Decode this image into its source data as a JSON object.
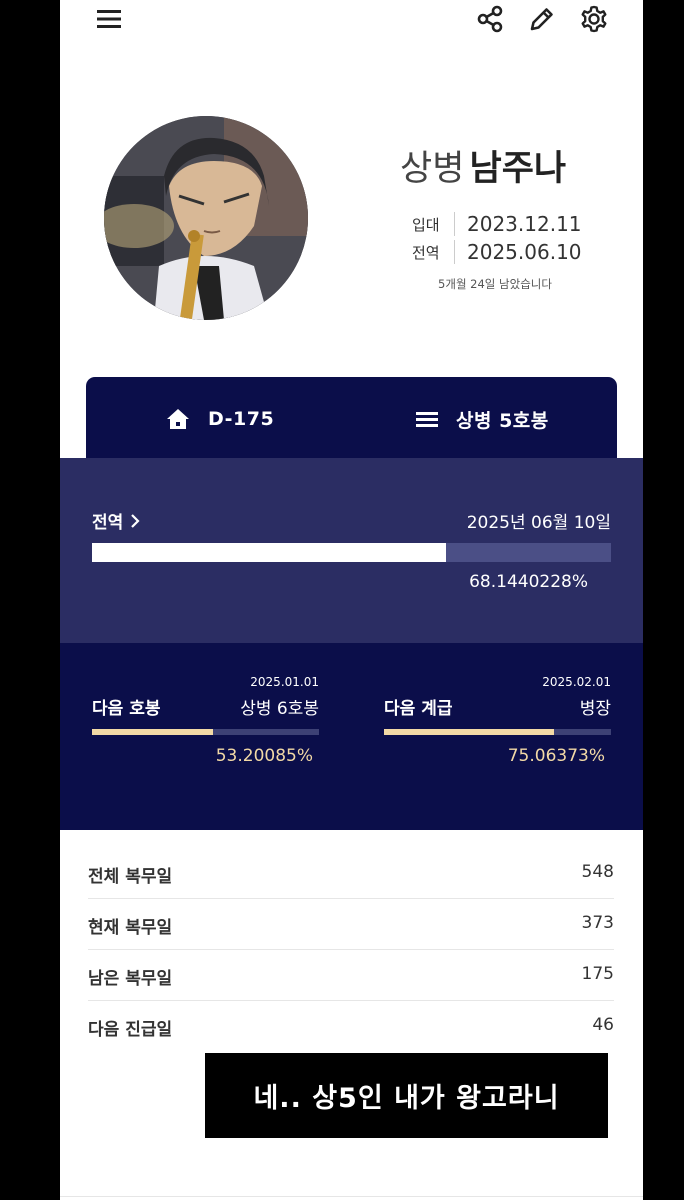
{
  "profile": {
    "rank": "상병",
    "name": "남주나",
    "enlist_label": "입대",
    "enlist_date": "2023.12.11",
    "discharge_label": "전역",
    "discharge_date": "2025.06.10",
    "remaining_text": "5개월 24일 남았습니다"
  },
  "summary_card": {
    "dday": "D-175",
    "pay_grade": "상병 5호봉"
  },
  "discharge_progress": {
    "label": "전역",
    "date": "2025년 06월 10일",
    "percent_text": "68.1440228%",
    "fraction": 0.681440228
  },
  "next_pay": {
    "label": "다음 호봉",
    "date": "2025.01.01",
    "value": "상병 6호봉",
    "percent_text": "53.20085%",
    "fraction": 0.5320085
  },
  "next_rank": {
    "label": "다음 계급",
    "date": "2025.02.01",
    "value": "병장",
    "percent_text": "75.06373%",
    "fraction": 0.7506373
  },
  "stats": [
    {
      "label": "전체 복무일",
      "value": "548"
    },
    {
      "label": "현재 복무일",
      "value": "373"
    },
    {
      "label": "남은 복무일",
      "value": "175"
    },
    {
      "label": "다음 진급일",
      "value": "46"
    }
  ],
  "caption": "네.. 상5인 내가 왕고라니",
  "icons": {
    "menu": "menu-icon",
    "share": "share-icon",
    "edit": "pencil-icon",
    "settings": "gear-icon",
    "home": "home-icon",
    "list": "list-icon",
    "chevron": "chevron-right-icon"
  },
  "colors": {
    "navy": "#0b0e4a",
    "discharge_bg": "#2b2d63",
    "gold": "#f2d9a6"
  }
}
